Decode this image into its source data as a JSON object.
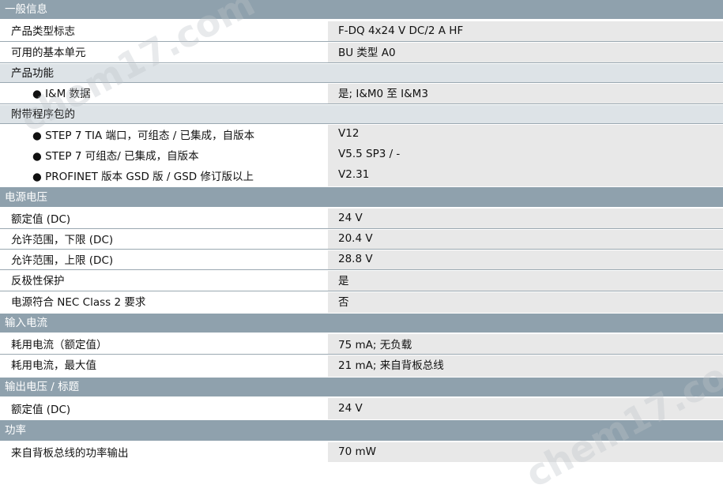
{
  "sections": [
    {
      "key": "general",
      "title": "一般信息"
    },
    {
      "key": "power",
      "title": "电源电压"
    },
    {
      "key": "input_current",
      "title": "输入电流"
    },
    {
      "key": "output_voltage",
      "title": "输出电压 / 标题"
    },
    {
      "key": "power_loss",
      "title": "功率"
    }
  ],
  "rows": {
    "product_type": {
      "label": "产品类型标志",
      "value": "F-DQ 4x24 V DC/2 A HF"
    },
    "base_unit": {
      "label": "可用的基本单元",
      "value": "BU 类型 A0"
    },
    "product_function": {
      "label": "产品功能"
    },
    "im_data": {
      "label": "● I&M 数据",
      "value": "是; I&M0 至 I&M3"
    },
    "engineering": {
      "label": "附带程序包的"
    },
    "step7_tia": {
      "label": "● STEP 7 TIA 端口，可组态 / 已集成，自版本",
      "value": "V12"
    },
    "step7": {
      "label": "● STEP 7 可组态/ 已集成，自版本",
      "value": "V5.5 SP3 / -"
    },
    "profinet": {
      "label": "● PROFINET 版本 GSD 版 / GSD 修订版以上",
      "value": "V2.31"
    },
    "rated_dc": {
      "label": "额定值 (DC)",
      "value": "24 V"
    },
    "range_low": {
      "label": "允许范围，下限 (DC)",
      "value": "20.4 V"
    },
    "range_high": {
      "label": "允许范围，上限 (DC)",
      "value": "28.8 V"
    },
    "reverse_polarity": {
      "label": "反极性保护",
      "value": "是"
    },
    "nec_class2": {
      "label": "电源符合 NEC Class 2 要求",
      "value": "否"
    },
    "current_rated": {
      "label": "耗用电流（额定值）",
      "value": "75 mA; 无负载"
    },
    "current_max": {
      "label": "耗用电流，最大值",
      "value": "21 mA; 来自背板总线"
    },
    "output_rated_dc": {
      "label": "额定值 (DC)",
      "value": "24 V"
    },
    "backplane_power": {
      "label": "来自背板总线的功率输出",
      "value": "70 mW"
    }
  },
  "watermark": "chem17.com"
}
